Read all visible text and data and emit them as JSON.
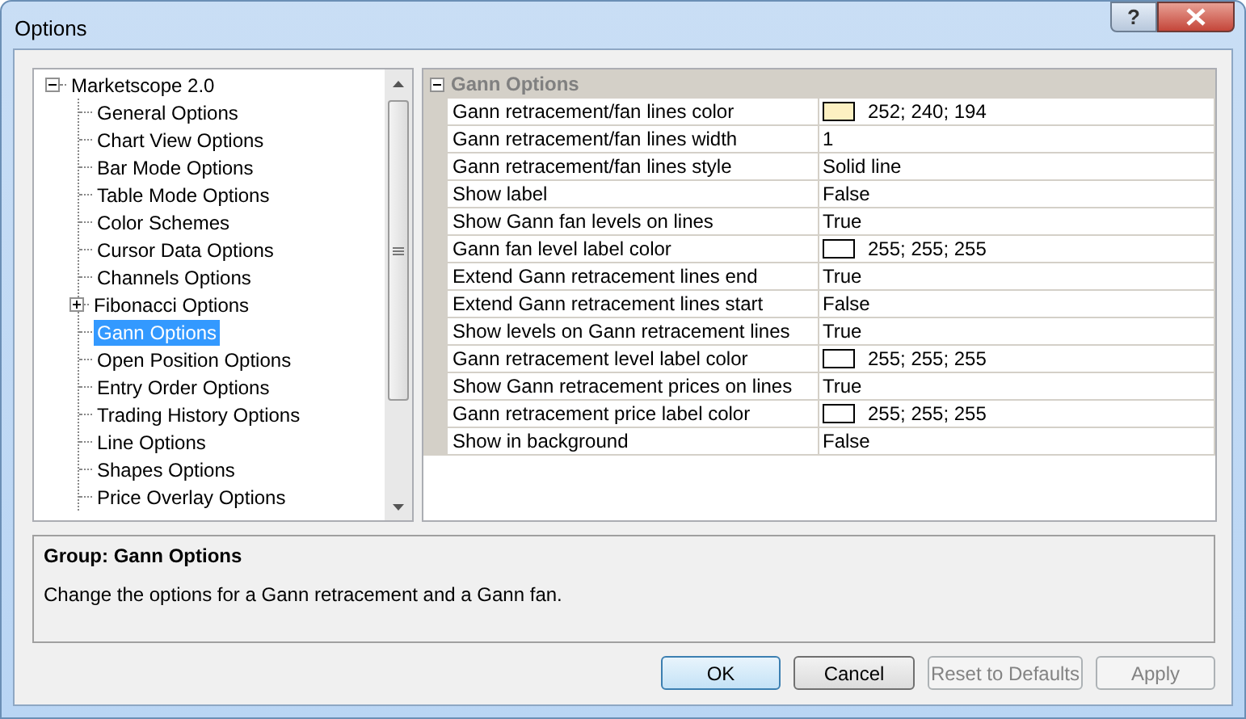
{
  "window": {
    "title": "Options",
    "help_button": "?"
  },
  "tree": {
    "label": "Marketscope 2.0",
    "expanded": true,
    "selected": false,
    "children": [
      {
        "label": "General Options",
        "selected": false
      },
      {
        "label": "Chart View Options",
        "selected": false
      },
      {
        "label": "Bar Mode Options",
        "selected": false
      },
      {
        "label": "Table Mode Options",
        "selected": false
      },
      {
        "label": "Color Schemes",
        "selected": false
      },
      {
        "label": "Cursor Data Options",
        "selected": false
      },
      {
        "label": "Channels Options",
        "selected": false
      },
      {
        "label": "Fibonacci Options",
        "selected": false,
        "expanded": false
      },
      {
        "label": "Gann Options",
        "selected": true
      },
      {
        "label": "Open Position Options",
        "selected": false
      },
      {
        "label": "Entry Order Options",
        "selected": false
      },
      {
        "label": "Trading History Options",
        "selected": false
      },
      {
        "label": "Line Options",
        "selected": false
      },
      {
        "label": "Shapes Options",
        "selected": false
      },
      {
        "label": "Price Overlay Options",
        "selected": false
      }
    ]
  },
  "properties": {
    "section": {
      "title": "Gann Options",
      "expanded": true
    },
    "rows": [
      {
        "name": "Gann retracement/fan lines color",
        "kind": "color",
        "value": "252; 240; 194",
        "color": "#fcf0c2"
      },
      {
        "name": "Gann retracement/fan lines width",
        "kind": "text",
        "value": "1"
      },
      {
        "name": "Gann retracement/fan lines style",
        "kind": "text",
        "value": "Solid line"
      },
      {
        "name": "Show label",
        "kind": "text",
        "value": "False"
      },
      {
        "name": "Show Gann fan levels on lines",
        "kind": "text",
        "value": "True"
      },
      {
        "name": "Gann fan level label color",
        "kind": "color",
        "value": "255; 255; 255",
        "color": "#ffffff"
      },
      {
        "name": "Extend Gann retracement lines end",
        "kind": "text",
        "value": "True"
      },
      {
        "name": "Extend Gann retracement lines start",
        "kind": "text",
        "value": "False"
      },
      {
        "name": "Show levels on Gann retracement lines",
        "kind": "text",
        "value": "True"
      },
      {
        "name": "Gann retracement level label color",
        "kind": "color",
        "value": "255; 255; 255",
        "color": "#ffffff"
      },
      {
        "name": "Show Gann retracement prices on lines",
        "kind": "text",
        "value": "True"
      },
      {
        "name": "Gann retracement price label color",
        "kind": "color",
        "value": "255; 255; 255",
        "color": "#ffffff"
      },
      {
        "name": "Show in background",
        "kind": "text",
        "value": "False"
      }
    ]
  },
  "description": {
    "title": "Group: Gann Options",
    "text": "Change the options for a Gann retracement and a Gann fan."
  },
  "buttons": [
    {
      "label": "OK",
      "default": true,
      "disabled": false
    },
    {
      "label": "Cancel",
      "default": false,
      "disabled": false
    },
    {
      "label": "Reset to Defaults",
      "default": false,
      "disabled": true
    },
    {
      "label": "Apply",
      "default": false,
      "disabled": true
    }
  ]
}
